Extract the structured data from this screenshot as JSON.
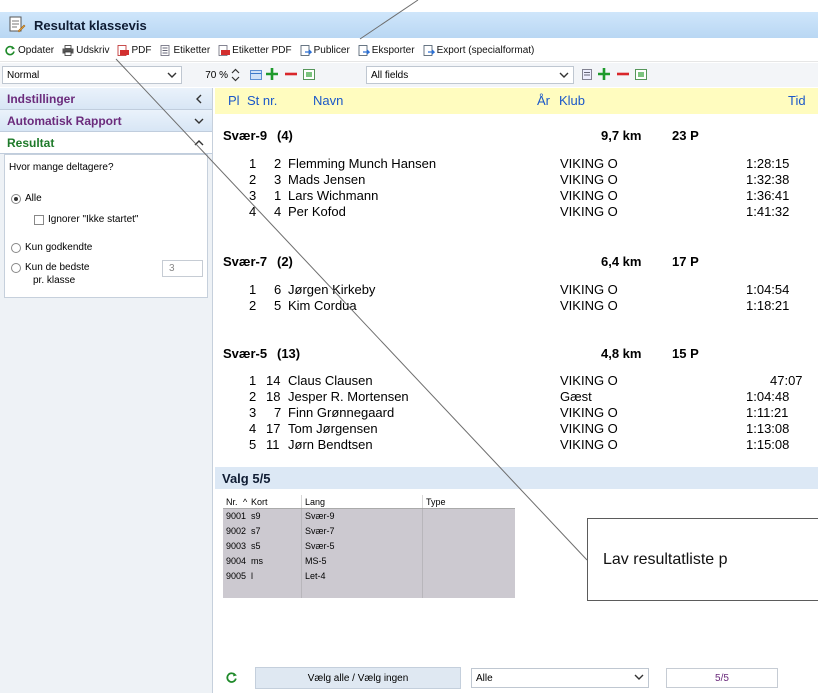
{
  "window": {
    "title": "Resultat klassevis"
  },
  "toolbar": {
    "items": [
      {
        "label": "Opdater",
        "icon": "refresh-icon"
      },
      {
        "label": "Udskriv",
        "icon": "printer-icon"
      },
      {
        "label": "PDF",
        "icon": "pdf-icon"
      },
      {
        "label": "Etiketter",
        "icon": "labels-icon"
      },
      {
        "label": "Etiketter PDF",
        "icon": "labels-pdf-icon"
      },
      {
        "label": "Publicer",
        "icon": "publish-icon"
      },
      {
        "label": "Eksporter",
        "icon": "export-icon"
      },
      {
        "label": "Export (specialformat)",
        "icon": "export-special-icon"
      }
    ]
  },
  "options": {
    "layout_select": "Normal",
    "zoom": "70 %",
    "fields_select": "All fields"
  },
  "sidebar": {
    "panels": [
      {
        "label": "Indstillinger"
      },
      {
        "label": "Automatisk Rapport"
      },
      {
        "label": "Resultat"
      }
    ],
    "question": "Hvor mange deltagere?",
    "opt_all": "Alle",
    "ignore_label": "Ignorer \"Ikke startet\"",
    "opt_approved": "Kun godkendte",
    "opt_best_line1": "Kun de bedste",
    "opt_best_line2": "pr. klasse",
    "best_value": "3"
  },
  "columns": {
    "pl": "Pl",
    "stnr": "St nr.",
    "navn": "Navn",
    "aar": "År",
    "klub": "Klub",
    "tid": "Tid"
  },
  "classes": [
    {
      "name": "Svær-9",
      "count": "(4)",
      "distance": "9,7 km",
      "points": "23 P",
      "rows": [
        {
          "pl": "1",
          "stnr": "2",
          "navn": "Flemming Munch Hansen",
          "klub": "VIKING O",
          "tid": "1:28:15"
        },
        {
          "pl": "2",
          "stnr": "3",
          "navn": "Mads Jensen",
          "klub": "VIKING O",
          "tid": "1:32:38"
        },
        {
          "pl": "3",
          "stnr": "1",
          "navn": "Lars Wichmann",
          "klub": "VIKING O",
          "tid": "1:36:41"
        },
        {
          "pl": "4",
          "stnr": "4",
          "navn": "Per Kofod",
          "klub": "VIKING O",
          "tid": "1:41:32"
        }
      ]
    },
    {
      "name": "Svær-7",
      "count": "(2)",
      "distance": "6,4 km",
      "points": "17 P",
      "rows": [
        {
          "pl": "1",
          "stnr": "6",
          "navn": "Jørgen Kirkeby",
          "klub": "VIKING O",
          "tid": "1:04:54"
        },
        {
          "pl": "2",
          "stnr": "5",
          "navn": "Kim Cordua",
          "klub": "VIKING O",
          "tid": "1:18:21"
        }
      ]
    },
    {
      "name": "Svær-5",
      "count": "(13)",
      "distance": "4,8 km",
      "points": "15 P",
      "rows": [
        {
          "pl": "1",
          "stnr": "14",
          "navn": "Claus Clausen",
          "klub": "VIKING O",
          "tid": "47:07"
        },
        {
          "pl": "2",
          "stnr": "18",
          "navn": "Jesper R. Mortensen",
          "klub": "Gæst",
          "tid": "1:04:48"
        },
        {
          "pl": "3",
          "stnr": "7",
          "navn": "Finn Grønnegaard",
          "klub": "VIKING O",
          "tid": "1:11:21"
        },
        {
          "pl": "4",
          "stnr": "17",
          "navn": "Tom Jørgensen",
          "klub": "VIKING O",
          "tid": "1:13:08"
        },
        {
          "pl": "5",
          "stnr": "11",
          "navn": "Jørn Bendtsen",
          "klub": "VIKING O",
          "tid": "1:15:08"
        }
      ]
    }
  ],
  "valg": {
    "title": "Valg 5/5",
    "headers": {
      "nr": "Nr.",
      "kort": "Kort",
      "lang": "Lang",
      "type": "Type"
    },
    "rows": [
      {
        "nr": "9001",
        "kort": "s9",
        "lang": "Svær-9"
      },
      {
        "nr": "9002",
        "kort": "s7",
        "lang": "Svær-7"
      },
      {
        "nr": "9003",
        "kort": "s5",
        "lang": "Svær-5"
      },
      {
        "nr": "9004",
        "kort": "ms",
        "lang": "MS-5"
      },
      {
        "nr": "9005",
        "kort": "l",
        "lang": "Let-4"
      }
    ],
    "select_all_label": "Vælg alle / Vælg ingen",
    "filter_value": "Alle",
    "count": "5/5"
  },
  "callout": {
    "text": "Lav resultatliste p"
  },
  "colors": {
    "accent_purple": "#6b2b7c",
    "accent_green": "#1e7a2a",
    "header_blue": "#1b58c9",
    "header_bg": "#fffcbf"
  }
}
